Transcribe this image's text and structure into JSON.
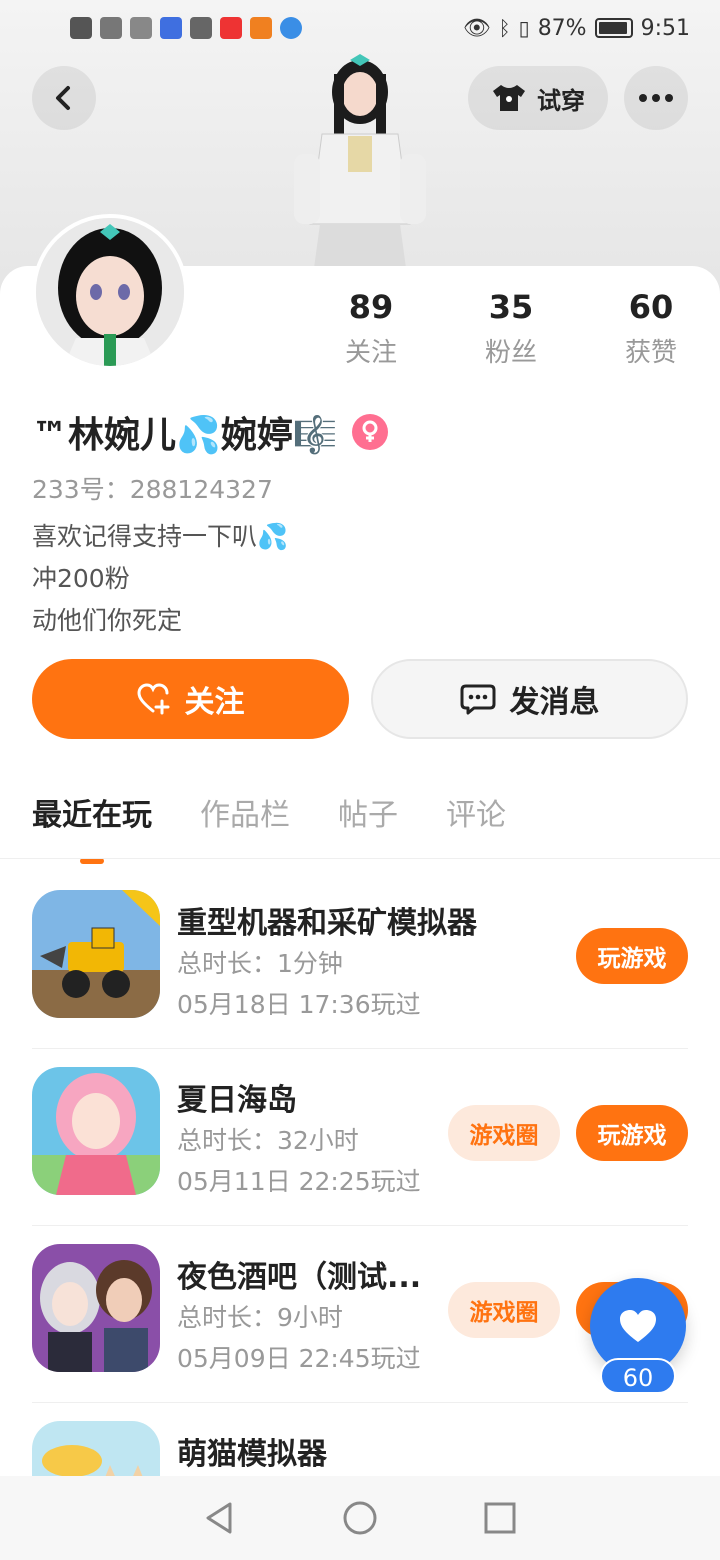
{
  "status_bar": {
    "battery": "87%",
    "time": "9:51"
  },
  "header": {
    "tryon_label": "试穿"
  },
  "profile": {
    "stats": [
      {
        "value": "89",
        "label": "关注"
      },
      {
        "value": "35",
        "label": "粉丝"
      },
      {
        "value": "60",
        "label": "获赞"
      }
    ],
    "nickname": "™林婉儿💦婉婷🎼",
    "uid": "233号：288124327",
    "bio_lines": [
      "喜欢记得支持一下叭💦",
      "冲200粉",
      "动他们你死定"
    ],
    "follow_label": "关注",
    "message_label": "发消息"
  },
  "tabs": [
    {
      "label": "最近在玩",
      "active": true
    },
    {
      "label": "作品栏",
      "active": false
    },
    {
      "label": "帖子",
      "active": false
    },
    {
      "label": "评论",
      "active": false
    }
  ],
  "games": [
    {
      "title": "重型机器和采矿模拟器",
      "duration": "总时长：1分钟",
      "last_played": "05月18日 17:36玩过",
      "play_label": "玩游戏",
      "icon": "mining-truck-icon"
    },
    {
      "title": "夏日海岛",
      "duration": "总时长：32小时",
      "last_played": "05月11日 22:25玩过",
      "circle_label": "游戏圈",
      "play_label": "玩游戏",
      "icon": "anime-girl-icon"
    },
    {
      "title": "夜色酒吧（测试...",
      "duration": "总时长：9小时",
      "last_played": "05月09日 22:45玩过",
      "circle_label": "游戏圈",
      "play_label": "玩游戏",
      "icon": "bar-couple-icon"
    },
    {
      "title": "萌猫模拟器",
      "icon": "cute-cat-icon"
    }
  ],
  "floating_like": {
    "count": "60"
  },
  "colors": {
    "accent": "#ff7311",
    "accent_light": "#fde9dc",
    "like_blue": "#2e7bef"
  }
}
